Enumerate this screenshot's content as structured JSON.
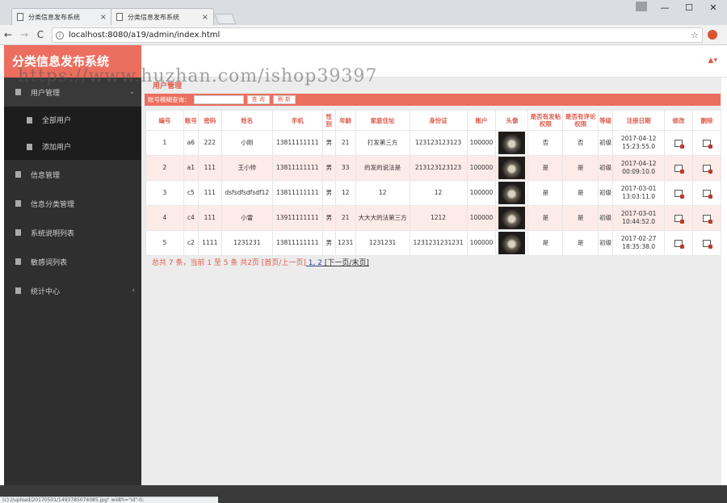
{
  "browser": {
    "tabs": [
      {
        "title": "分类信息发布系统",
        "close": "×"
      },
      {
        "title": "分类信息发布系统",
        "close": "×"
      }
    ],
    "url": "localhost:8080/a19/admin/index.html",
    "nav": {
      "back": "←",
      "forward": "→",
      "reload": "C",
      "star": "☆"
    },
    "window_controls": {
      "min": "—",
      "max": "☐",
      "close": "✕"
    },
    "status_url": "(c)://upload/20170501/1493785074085.jpg\" width=\"id\":0;"
  },
  "header": {
    "logo": "分类信息发布系统",
    "user_icon": "▲▾"
  },
  "watermark": "https://www.huzhan.com/ishop39397",
  "sidebar": {
    "items": [
      {
        "label": "用户管理",
        "arrow": "⌄",
        "children": [
          {
            "label": "全部用户"
          },
          {
            "label": "添加用户"
          }
        ]
      },
      {
        "label": "信息管理"
      },
      {
        "label": "信息分类管理"
      },
      {
        "label": "系统说明列表"
      },
      {
        "label": "敏感词列表"
      },
      {
        "label": "统计中心",
        "arrow": "‹"
      }
    ]
  },
  "main": {
    "breadcrumb": "用户管理",
    "search": {
      "label": "账号模糊查询：",
      "value": "",
      "query_btn": "查 询",
      "refresh_btn": "刷 新"
    },
    "columns": [
      "编号",
      "账号",
      "密码",
      "姓名",
      "手机",
      "性别",
      "年龄",
      "家庭住址",
      "身份证",
      "账户",
      "头像",
      "是否有发帖权限",
      "是否有评论权限",
      "等级",
      "注册日期",
      "修改",
      "删除"
    ],
    "rows": [
      {
        "id": "1",
        "account": "a6",
        "password": "222",
        "name": "小刚",
        "phone": "13811111111",
        "gender": "男",
        "age": "21",
        "address": "打发第三方",
        "idcard": "123123123123",
        "balance": "100000",
        "can_post": "否",
        "can_comment": "否",
        "level": "初级",
        "date": "2017-04-12 15:23:55.0"
      },
      {
        "id": "2",
        "account": "a1",
        "password": "111",
        "name": "王小帅",
        "phone": "13811111111",
        "gender": "男",
        "age": "33",
        "address": "的发的说法是",
        "idcard": "213123123123",
        "balance": "100000",
        "can_post": "是",
        "can_comment": "是",
        "level": "初级",
        "date": "2017-04-12 00:09:10.0"
      },
      {
        "id": "3",
        "account": "c5",
        "password": "111",
        "name": "dsfsdfsdfsdf12",
        "phone": "13811111111",
        "gender": "男",
        "age": "12",
        "address": "12",
        "idcard": "12",
        "balance": "100000",
        "can_post": "是",
        "can_comment": "是",
        "level": "初级",
        "date": "2017-03-01 13:03:11.0"
      },
      {
        "id": "4",
        "account": "c4",
        "password": "111",
        "name": "小雷",
        "phone": "13911111111",
        "gender": "男",
        "age": "21",
        "address": "大大大的法第三方",
        "idcard": "1212",
        "balance": "100000",
        "can_post": "是",
        "can_comment": "是",
        "level": "初级",
        "date": "2017-03-01 10:44:52.0"
      },
      {
        "id": "5",
        "account": "c2",
        "password": "1111",
        "name": "1231231",
        "phone": "13811111111",
        "gender": "男",
        "age": "1231",
        "address": "1231231",
        "idcard": "1231231231231",
        "balance": "100000",
        "can_post": "是",
        "can_comment": "是",
        "level": "初级",
        "date": "2017-02-27 18:35:38.0"
      }
    ],
    "pager": {
      "summary": "总共 7 条，当前 1 至 5 条 共2页 ",
      "first_prev": "[首页/上一页]",
      "page1": " 1,",
      "page2": " 2",
      "next": " [下一页/",
      "last": "末页]"
    }
  }
}
